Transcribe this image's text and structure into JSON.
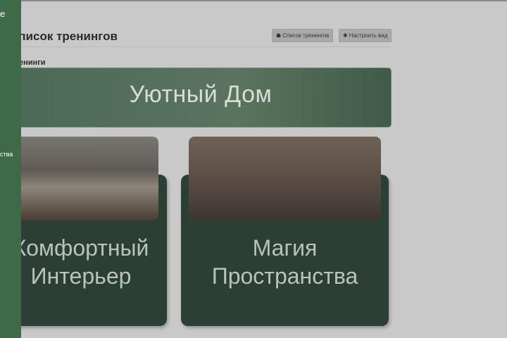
{
  "header": {
    "title": "Список тренингов",
    "list_button": "Список тренингов",
    "customize_button": "Настроить вид"
  },
  "section": {
    "title": "Тренинги"
  },
  "banner": {
    "title": "Уютный Дом"
  },
  "cards": [
    {
      "title_line1": "Комфортный",
      "title_line2": "Интерьер"
    },
    {
      "title_line1": "Магия",
      "title_line2": "Пространства"
    }
  ],
  "sidebar": {
    "item_top": "е",
    "item_mid": "ства"
  }
}
